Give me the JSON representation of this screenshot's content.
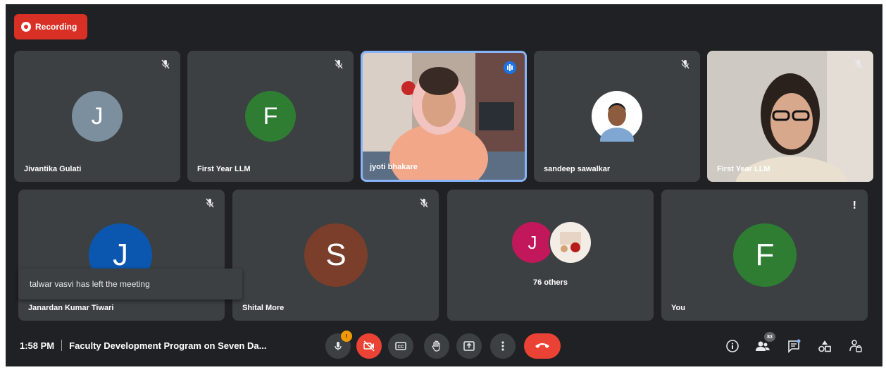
{
  "recording": {
    "label": "Recording"
  },
  "tiles": [
    {
      "name": "Jivantika Gulati",
      "initial": "J",
      "color": "#7b8f9e"
    },
    {
      "name": "First Year LLM",
      "initial": "F",
      "color": "#2e7d32"
    },
    {
      "name": "jyoti bhakare"
    },
    {
      "name": "sandeep sawalkar"
    },
    {
      "name": "First Year LLM"
    },
    {
      "name": "Janardan Kumar Tiwari",
      "initial": "J",
      "color": "#0b57b0"
    },
    {
      "name": "Shital More",
      "initial": "S",
      "color": "#7a3e2b"
    },
    {
      "others_label": "76 others",
      "initial": "J",
      "color": "#c2185b"
    },
    {
      "name": "You",
      "initial": "F",
      "color": "#2e7d32"
    }
  ],
  "toast": {
    "message": "talwar vasvi has left the meeting"
  },
  "meeting": {
    "time": "1:58 PM",
    "title": "Faculty Development Program on Seven Da..."
  },
  "controls": {
    "mic_badge": "!",
    "participants_count": "83"
  },
  "colors": {
    "background": "#202124",
    "tile": "#3c4043",
    "danger": "#ea4335",
    "speaking": "#8ab4f8"
  }
}
